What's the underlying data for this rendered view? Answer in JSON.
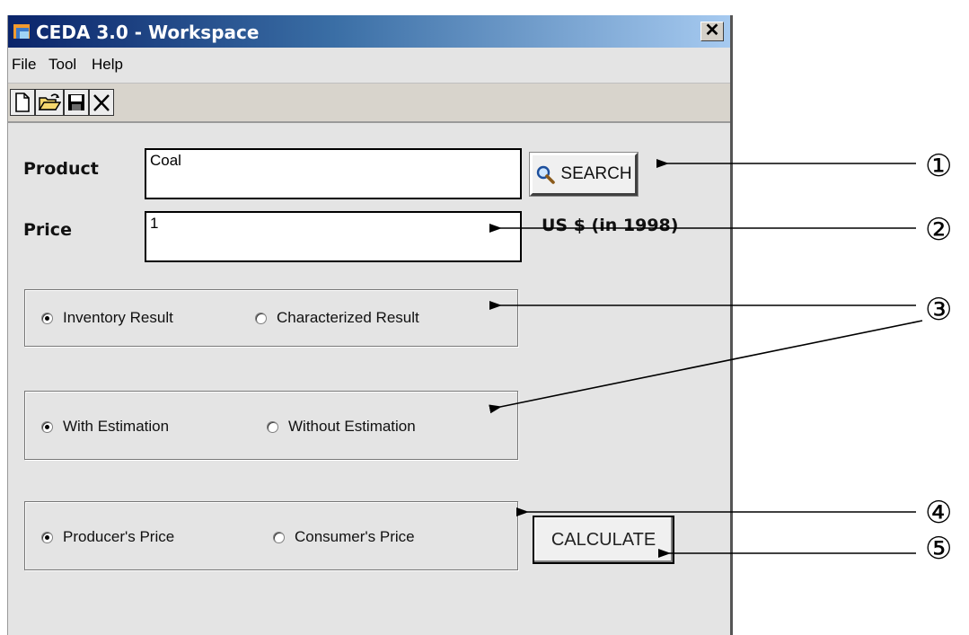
{
  "window": {
    "title": "CEDA 3.0 - Workspace",
    "close_label": "✕"
  },
  "menu": [
    "File",
    "Tool",
    "Help"
  ],
  "toolbar": {
    "buttons": [
      {
        "icon": "new-document-icon"
      },
      {
        "icon": "open-folder-icon"
      },
      {
        "icon": "save-disk-icon"
      },
      {
        "icon": "delete-x-icon"
      }
    ]
  },
  "form": {
    "product_label": "Product",
    "product_value": "Coal",
    "search_label": "SEARCH",
    "price_label": "Price",
    "price_value": "1",
    "price_unit": "US $ (in 1998)"
  },
  "groups": {
    "result": {
      "options": [
        "Inventory Result",
        "Characterized Result"
      ],
      "selected": 0
    },
    "estimation": {
      "options": [
        "With Estimation",
        "Without Estimation"
      ],
      "selected": 0
    },
    "price_type": {
      "options": [
        "Producer's Price",
        "Consumer's Price"
      ],
      "selected": 0
    }
  },
  "calculate_label": "CALCULATE",
  "callouts": [
    "①",
    "②",
    "③",
    "④",
    "⑤"
  ],
  "colors": {
    "title_start": "#0a246a",
    "title_end": "#a6caf0",
    "window_bg": "#e4e4e4"
  }
}
